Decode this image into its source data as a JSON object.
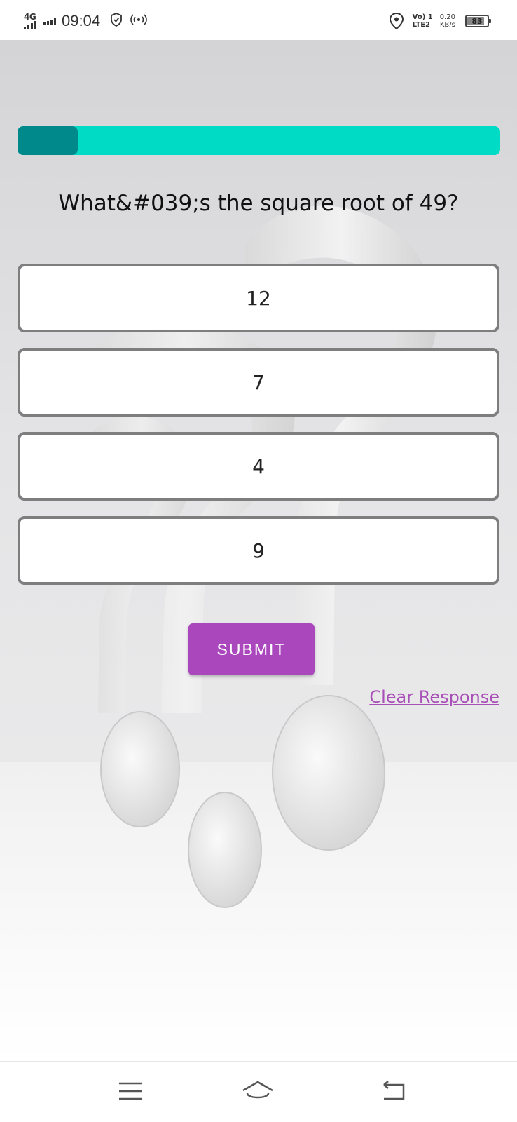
{
  "status_bar": {
    "network_type": "4G",
    "time": "09:04",
    "volte_line1": "Vo) 1",
    "volte_line2": "LTE2",
    "speed_value": "0.20",
    "speed_unit": "KB/s",
    "battery_level": "83"
  },
  "quiz": {
    "progress_fraction": 0.125,
    "question": "What&#039;s the square root of 49?",
    "options": [
      {
        "label": "12"
      },
      {
        "label": "7"
      },
      {
        "label": "4"
      },
      {
        "label": "9"
      }
    ],
    "submit_label": "SUBMIT",
    "clear_label": "Clear Response"
  },
  "colors": {
    "progress_track": "#00dbc6",
    "progress_fill": "#00898a",
    "submit_button": "#ab47bc",
    "clear_link": "#a94fb8"
  },
  "nav_bar": {
    "icons": [
      "menu-icon",
      "home-icon",
      "back-icon"
    ]
  }
}
